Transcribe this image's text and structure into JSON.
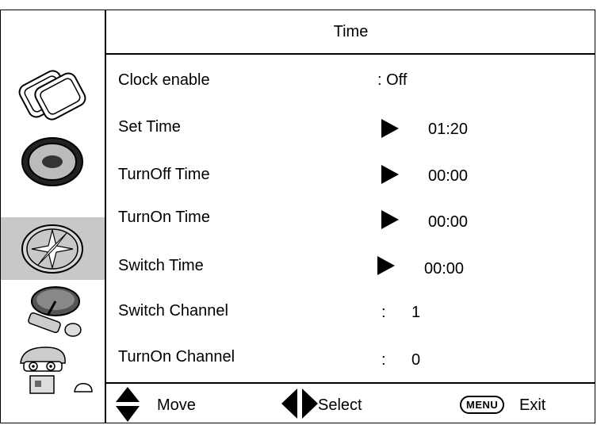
{
  "menu": {
    "title": "Time",
    "rows": [
      {
        "label": "Clock enable",
        "value": ": Off"
      },
      {
        "label": "Set Time",
        "value": "01:20"
      },
      {
        "label": "TurnOff Time",
        "value": "00:00"
      },
      {
        "label": "TurnOn Time",
        "value": "00:00"
      },
      {
        "label": "Switch Time",
        "value": "00:00"
      },
      {
        "label": "Switch Channel",
        "sep": ":",
        "value": "1"
      },
      {
        "label": "TurnOn Channel",
        "sep": ":",
        "value": "0"
      }
    ]
  },
  "footer": {
    "move": "Move",
    "select": "Select",
    "menu_key": "MENU",
    "exit": "Exit"
  },
  "sidebar": {
    "icons": [
      "picture-icon",
      "sound-disc-icon",
      "time-compass-icon",
      "satellite-dish-icon",
      "cartoon-setup-icon"
    ],
    "selected": "time-compass-icon"
  },
  "colors": {
    "selection": "#c8c8c8",
    "foreground": "#000000"
  }
}
